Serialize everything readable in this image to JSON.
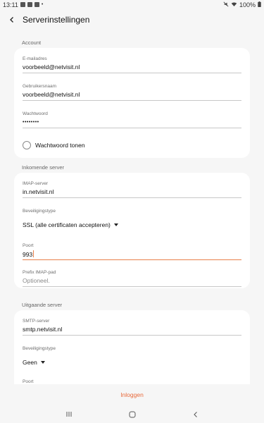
{
  "status_bar": {
    "time": "13:11",
    "battery": "100%",
    "icons": [
      "photo-icon",
      "mail-icon",
      "photo-icon",
      "more-icon"
    ],
    "right_icons": [
      "mute-icon",
      "wifi-icon",
      "battery-icon"
    ]
  },
  "app_bar": {
    "title": "Serverinstellingen",
    "back_icon": "arrow-left-icon"
  },
  "account": {
    "header": "Account",
    "email_label": "E-mailadres",
    "email_value": "voorbeeld@netvisit.nl",
    "username_label": "Gebruikersnaam",
    "username_value": "voorbeeld@netvisit.nl",
    "password_label": "Wachtwoord",
    "password_value": "••••••••",
    "show_password_label": "Wachtwoord tonen"
  },
  "incoming": {
    "header": "Inkomende server",
    "server_label": "IMAP-server",
    "server_value": "in.netvisit.nl",
    "security_label": "Beveiligingstype",
    "security_value": "SSL (alle certificaten accepteren)",
    "port_label": "Poort",
    "port_value": "993",
    "prefix_label": "Prefix IMAP-pad",
    "prefix_placeholder": "Optioneel."
  },
  "outgoing": {
    "header": "Uitgaande server",
    "server_label": "SMTP-server",
    "server_value": "smtp.netvisit.nl",
    "security_label": "Beveiligingstype",
    "security_value": "Geen",
    "port_label": "Poort"
  },
  "actions": {
    "login_label": "Inloggen"
  },
  "colors": {
    "accent": "#e8693a",
    "background": "#f6f6f6",
    "card": "#ffffff"
  }
}
